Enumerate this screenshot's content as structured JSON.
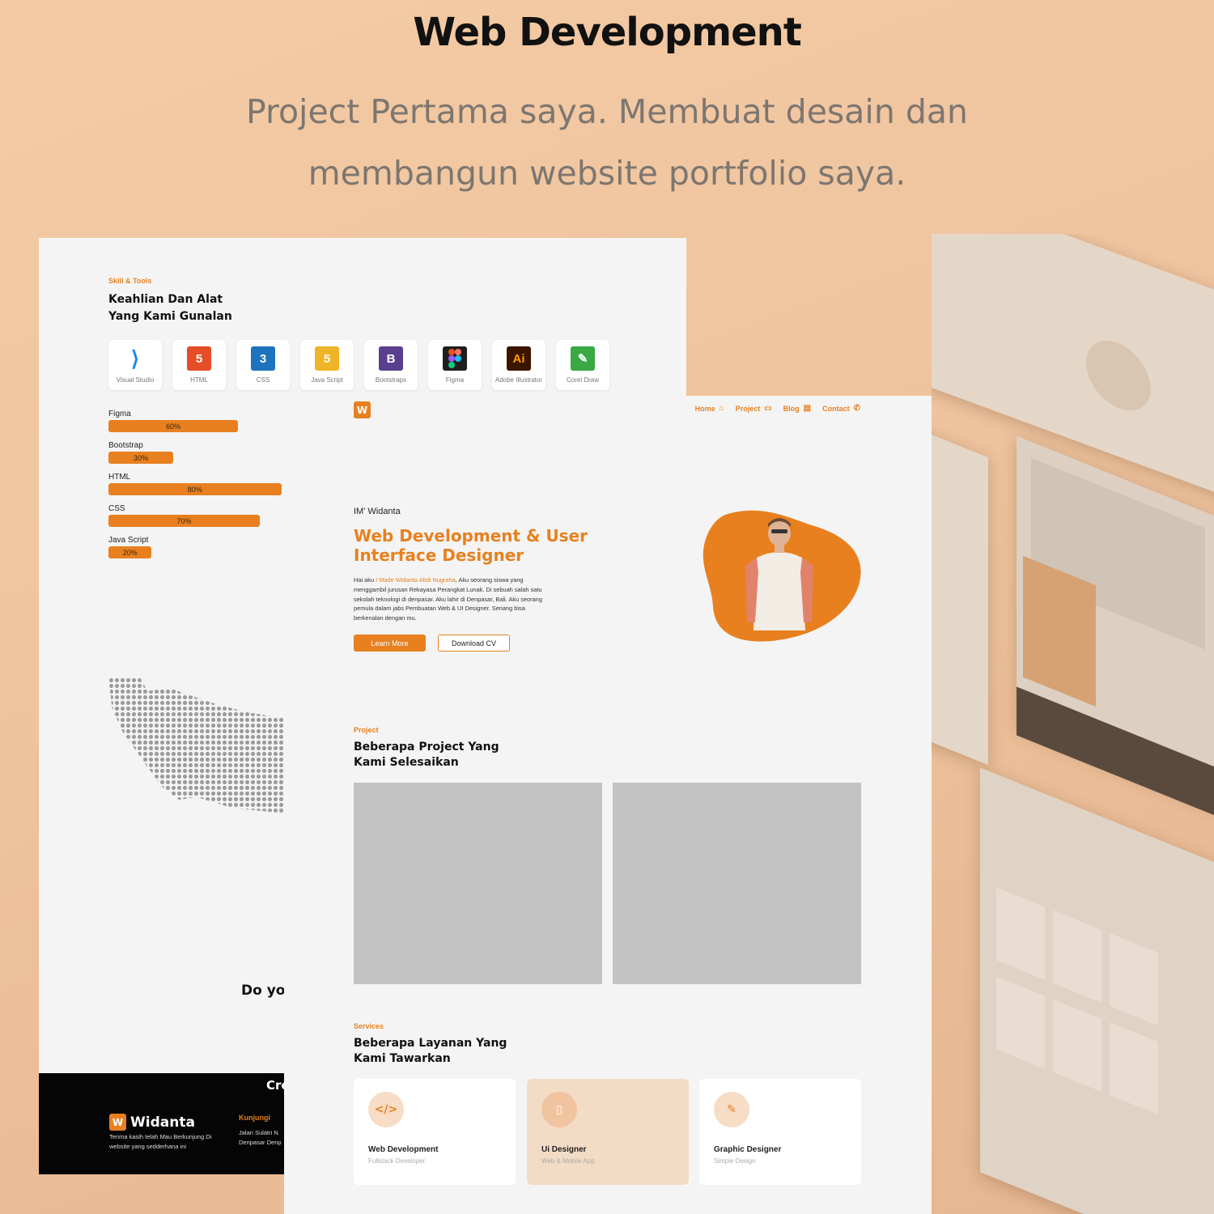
{
  "hero": {
    "title": "Web Development",
    "subtitle": "Project Pertama saya. Membuat desain dan membangun website portfolio saya."
  },
  "back_page": {
    "eyebrow": "Skill & Tools",
    "heading_line1": "Keahlian Dan Alat",
    "heading_line2": "Yang Kami Gunalan",
    "tools": [
      {
        "label": "Visual Studio",
        "icon": "vscode-icon",
        "color": "#1e88e5"
      },
      {
        "label": "HTML",
        "icon": "html5-icon",
        "color": "#e44d26"
      },
      {
        "label": "CSS",
        "icon": "css3-icon",
        "color": "#1e73be"
      },
      {
        "label": "Java Script",
        "icon": "javascript-icon",
        "color": "#f0b429"
      },
      {
        "label": "Bootstraps",
        "icon": "bootstrap-icon",
        "color": "#5b3f8f"
      },
      {
        "label": "Figma",
        "icon": "figma-icon",
        "color": "#1e1e1e"
      },
      {
        "label": "Adobe Illustrator",
        "icon": "illustrator-icon",
        "color": "#3a1500"
      },
      {
        "label": "Corel Draw",
        "icon": "coreldraw-icon",
        "color": "#3aa845"
      }
    ],
    "skills": [
      {
        "name": "Figma",
        "percent": "60%",
        "value": 60
      },
      {
        "name": "Bootstrap",
        "percent": "30%",
        "value": 30
      },
      {
        "name": "HTML",
        "percent": "80%",
        "value": 80
      },
      {
        "name": "CSS",
        "percent": "70%",
        "value": 70
      },
      {
        "name": "Java Script",
        "percent": "20%",
        "value": 20
      }
    ],
    "do_text": "Do yo",
    "footer": {
      "created": "Cre",
      "brand": "Widanta",
      "tagline": "Terima kasih telah Mau Berkunjung Di website yang sedderhana ini",
      "visit_label": "Kunjungi",
      "address": "Jalan Sulatri N Denpasar Denp"
    }
  },
  "front_page": {
    "nav": [
      {
        "label": "Home",
        "icon": "home-icon",
        "glyph": "⌂"
      },
      {
        "label": "Project",
        "icon": "project-icon",
        "glyph": "▭"
      },
      {
        "label": "Blog",
        "icon": "blog-icon",
        "glyph": "▤"
      },
      {
        "label": "Contact",
        "icon": "phone-icon",
        "glyph": "✆"
      }
    ],
    "greeting": "IM' Widanta",
    "headline": "Web Development & User Interface Designer",
    "intro_prefix": "Hai aku ",
    "intro_name": "I Made Widanta Abdi Nugraha",
    "intro_rest": ", Aku seorang siswa yang menggambil jurusan Rekayasa Perangkat Lunak. Di sebuah salah satu sekolah teknologi di denpasar. Aku lahir di Denpasar, Bali. Aku seorang pemula dalam jabs Pembuatan Web & UI Designer. Senang bisa berkenalan dengan mu.",
    "btn_learn": "Learn More",
    "btn_cv": "Download CV",
    "project_label": "Project",
    "project_title_1": "Beberapa Project Yang",
    "project_title_2": "Kami Selesaikan",
    "services_label": "Services",
    "services_title_1": "Beberapa Layanan Yang",
    "services_title_2": "Kami Tawarkan",
    "services": [
      {
        "title": "Web Development",
        "subtitle": "Fullstack Developer",
        "icon": "code-icon",
        "glyph": "</>"
      },
      {
        "title": "Ui Designer",
        "subtitle": "Web & Mobile App",
        "icon": "mobile-icon",
        "glyph": "▯"
      },
      {
        "title": "Graphic Designer",
        "subtitle": "Simple Design",
        "icon": "brush-icon",
        "glyph": "✎"
      }
    ]
  },
  "colors": {
    "accent": "#e8801f",
    "background": "#f4cba4",
    "page": "#f4f4f4"
  }
}
